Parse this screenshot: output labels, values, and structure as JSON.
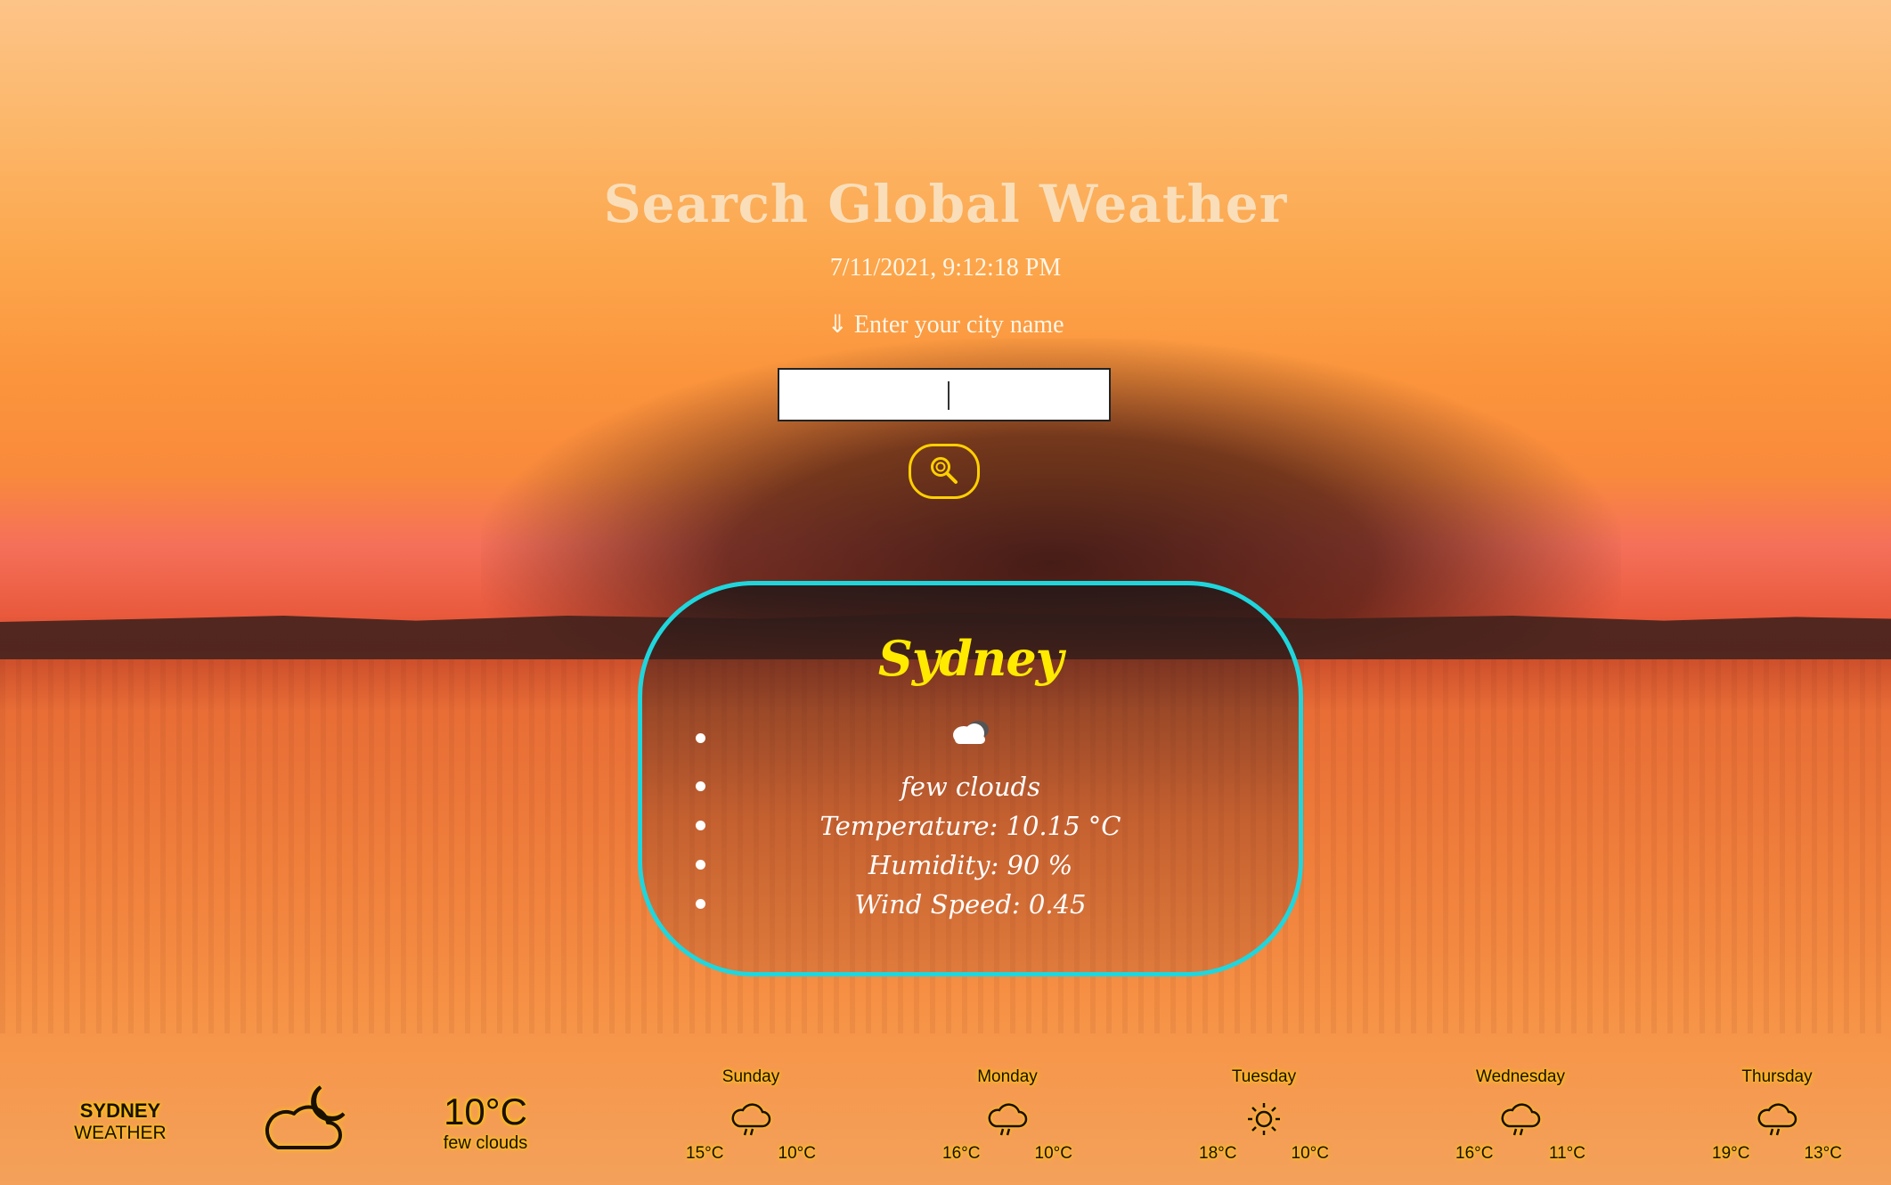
{
  "header": {
    "title": "Search Global Weather",
    "datetime": "7/11/2021, 9:12:18 PM",
    "prompt": "⇓ Enter your city name"
  },
  "search": {
    "value": "",
    "button_icon": "search-icon"
  },
  "card": {
    "city": "Sydney",
    "icon": "cloud-icon",
    "description": "few clouds",
    "temperature": "Temperature: 10.15 °C",
    "humidity": "Humidity: 90 %",
    "wind": "Wind Speed: 0.45"
  },
  "bottom_bar": {
    "city": "SYDNEY",
    "city_sub": "WEATHER",
    "current_icon": "cloud-moon-icon",
    "current_temp": "10°C",
    "current_desc": "few clouds",
    "forecast": [
      {
        "day": "Sunday",
        "icon": "cloud-rain-icon",
        "high": "15°C",
        "low": "10°C"
      },
      {
        "day": "Monday",
        "icon": "cloud-rain-icon",
        "high": "16°C",
        "low": "10°C"
      },
      {
        "day": "Tuesday",
        "icon": "sun-icon",
        "high": "18°C",
        "low": "10°C"
      },
      {
        "day": "Wednesday",
        "icon": "cloud-rain-icon",
        "high": "16°C",
        "low": "11°C"
      },
      {
        "day": "Thursday",
        "icon": "cloud-rain-icon",
        "high": "19°C",
        "low": "13°C"
      }
    ]
  },
  "colors": {
    "card_border": "#1fd6dd",
    "city_title": "#ffea00",
    "search_button_border": "#ffd000",
    "widget_glow": "#ffd000"
  }
}
